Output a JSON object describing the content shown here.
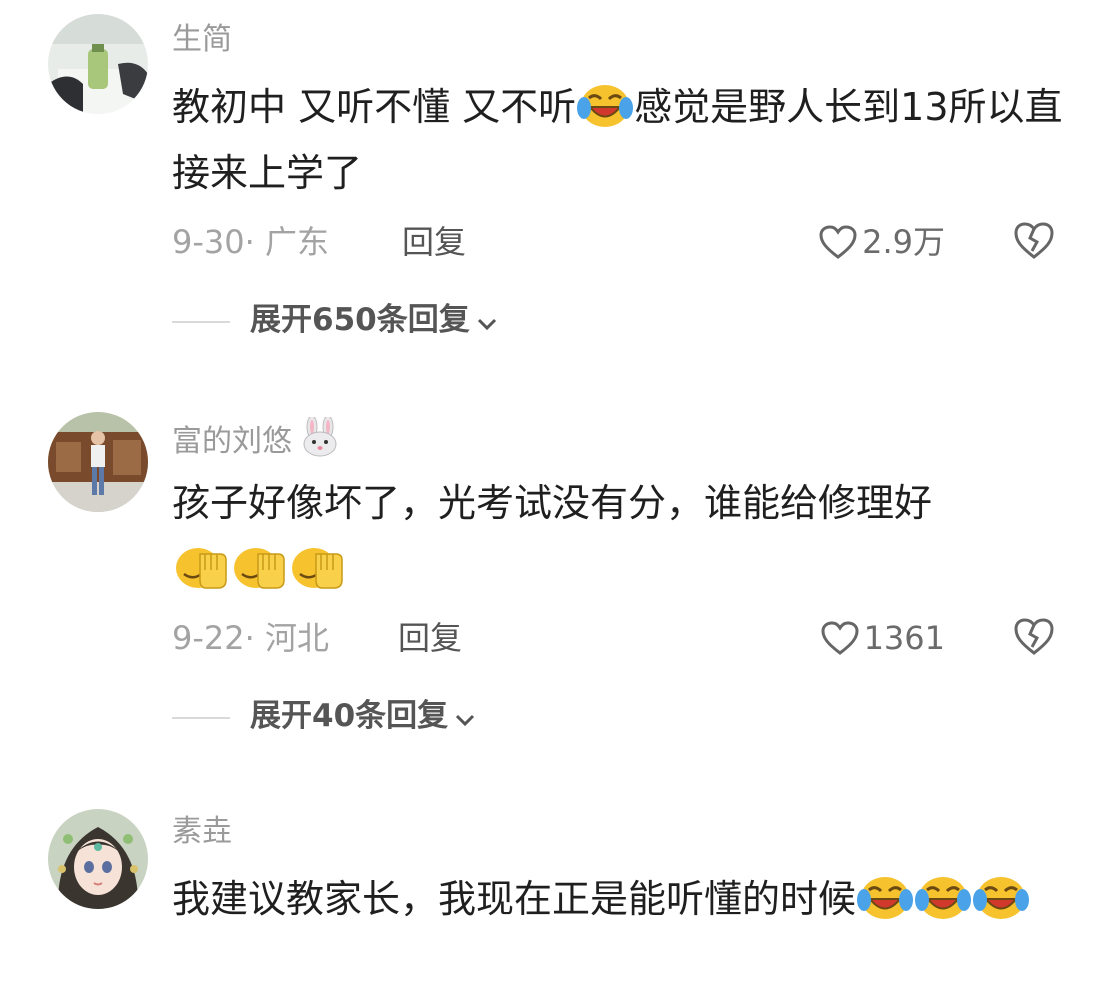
{
  "colors": {
    "background": "#ffffff",
    "username": "#9a9a9a",
    "meta": "#a3a3a3",
    "text": "#1f1f1f",
    "emoji_yellow": "#f6c22e"
  },
  "comments": [
    {
      "username": "生简",
      "text_parts": [
        "教初中 又听不懂 又不听",
        "感觉是野人长到13所以直接来上学了"
      ],
      "emoji": "laughing-crying-face-icon",
      "date": "9-30",
      "location": "广东",
      "reply_label": "回复",
      "likes": "2.9万",
      "expand_label": "展开650条回复"
    },
    {
      "username": "富的刘悠",
      "username_icon": "rabbit-face-icon",
      "text_parts": [
        "孩子好像坏了，光考试没有分，谁能给修理好"
      ],
      "emoji": "face-palm-icon",
      "date": "9-22",
      "location": "河北",
      "reply_label": "回复",
      "likes": "1361",
      "expand_label": "展开40条回复"
    },
    {
      "username": "素垚",
      "text_parts": [
        "我建议教家长，我现在正是能听懂的时候"
      ],
      "emoji": "laughing-crying-face-icon"
    }
  ]
}
